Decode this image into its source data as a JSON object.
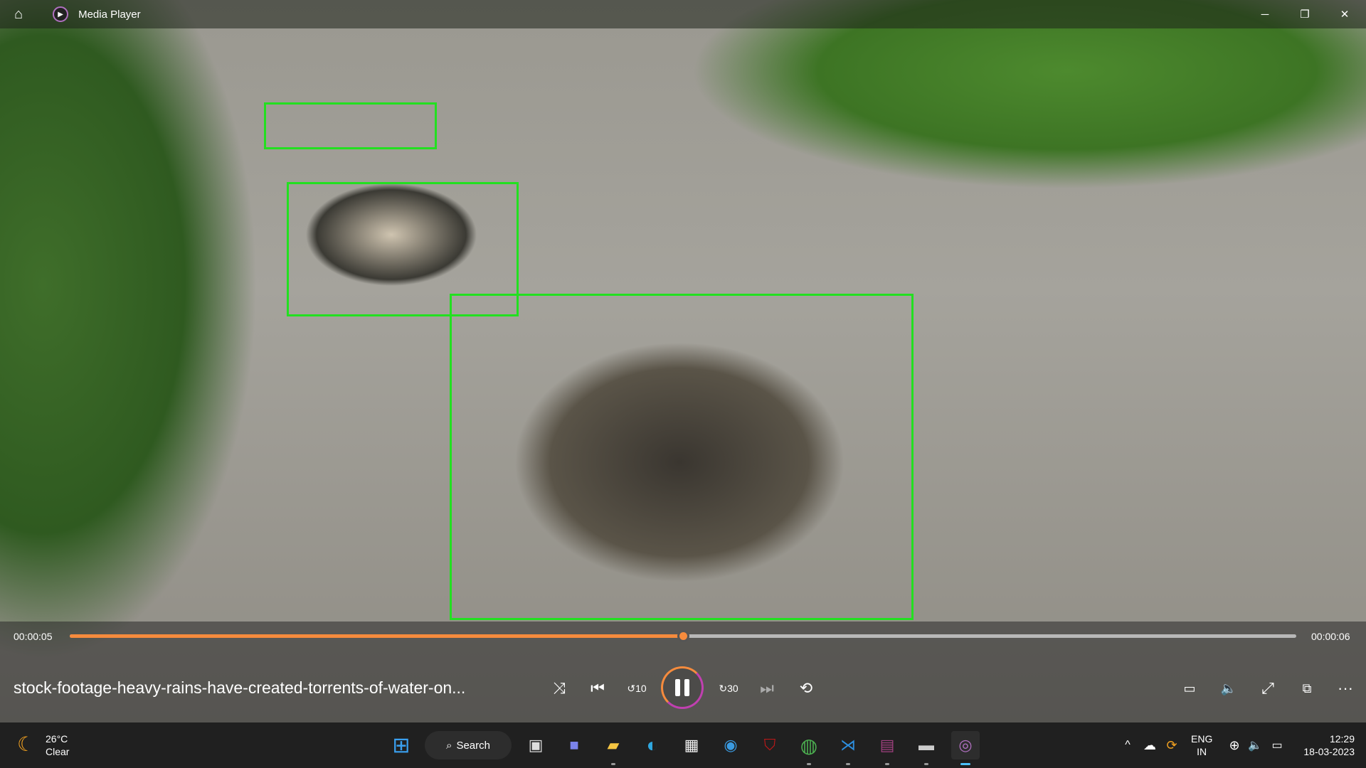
{
  "window": {
    "title": "Media Player",
    "minimize": "─",
    "restore": "❐",
    "close": "✕"
  },
  "player": {
    "current_time": "00:00:05",
    "total_time": "00:00:06",
    "progress_percent": 50,
    "file_title": "stock-footage-heavy-rains-have-created-torrents-of-water-on...",
    "controls": [
      "shuffle-icon",
      "previous-icon",
      "rewind-10-icon",
      "pause-icon",
      "forward-30-icon",
      "next-icon",
      "repeat-off-icon"
    ],
    "right_controls": [
      "subtitles-icon",
      "volume-icon",
      "fullscreen-icon",
      "mini-player-icon",
      "more-icon"
    ],
    "rewind_label": "10",
    "forward_label": "30",
    "more_label": "···"
  },
  "detections": {
    "color": "#22e020",
    "count": 3
  },
  "accent": "#f68b3d",
  "taskbar": {
    "weather": {
      "temp": "26°C",
      "condition": "Clear"
    },
    "search_label": "Search",
    "apps": [
      "start",
      "search",
      "task-view",
      "teams",
      "file-explorer",
      "edge",
      "store",
      "unknown-app",
      "mcafee",
      "chrome",
      "vscode",
      "winrar",
      "terminal",
      "media-player"
    ],
    "tray": {
      "lang1": "ENG",
      "lang2": "IN",
      "time": "12:29",
      "date": "18-03-2023"
    }
  }
}
